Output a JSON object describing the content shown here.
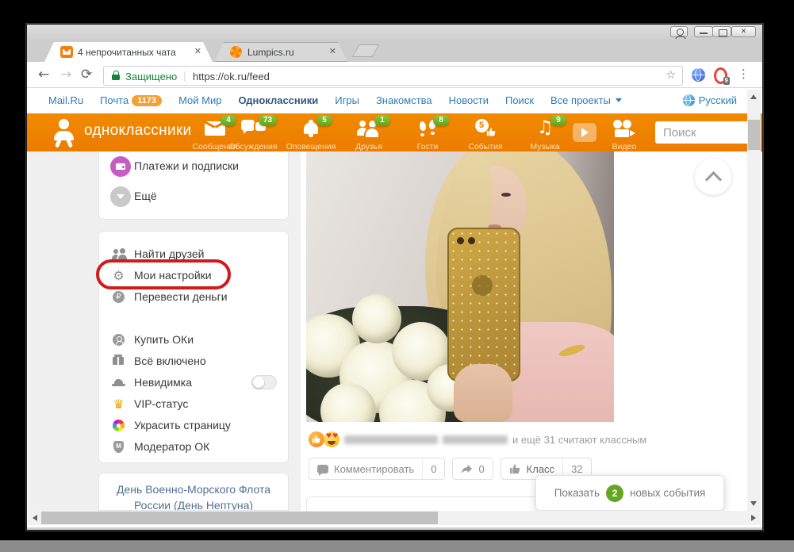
{
  "colors": {
    "accent_orange": "#ee7d00",
    "badge_green": "#76b82e",
    "nav_blue": "#2d7cb8",
    "annotation_red": "#d11a1a",
    "toast_green": "#63a620",
    "security_green": "#188038"
  },
  "browser": {
    "tabs": [
      {
        "title": "4 непрочитанных чата",
        "close": "✕"
      },
      {
        "title": "Lumpics.ru",
        "close": "✕"
      }
    ],
    "toolbar": {
      "back": "←",
      "forward": "→",
      "reload": "⟳",
      "security_label": "Защищено",
      "divider": "|",
      "url": "https://ok.ru/feed",
      "star": "☆",
      "ext_badge": "9",
      "menu": "⋮"
    }
  },
  "topnav": {
    "items": [
      {
        "label": "Mail.Ru"
      },
      {
        "label": "Почта",
        "badge": "1173"
      },
      {
        "label": "Мой Мир"
      },
      {
        "label": "Одноклассники"
      },
      {
        "label": "Игры"
      },
      {
        "label": "Знакомства"
      },
      {
        "label": "Новости"
      },
      {
        "label": "Поиск"
      },
      {
        "label": "Все проекты"
      }
    ],
    "language": "Русский"
  },
  "okheader": {
    "logo_text": "одноклассники",
    "nav": [
      {
        "label": "Сообщения",
        "badge": "4"
      },
      {
        "label": "Обсуждения",
        "badge": "73"
      },
      {
        "label": "Оповещения",
        "badge": "5"
      },
      {
        "label": "Друзья",
        "badge": "1"
      },
      {
        "label": "Гости",
        "badge": "8"
      },
      {
        "label": "События",
        "icon_digit": "5"
      },
      {
        "label": "Музыка",
        "badge": "9",
        "note_glyph": "♫"
      },
      {
        "label": "Видео"
      }
    ],
    "search_placeholder": "Поиск"
  },
  "sidebar": {
    "top": [
      {
        "label": "Платежи и подписки"
      },
      {
        "label": "Ещё"
      }
    ],
    "menu": [
      {
        "label": "Найти друзей"
      },
      {
        "label": "Мои настройки",
        "gear_glyph": "⚙"
      },
      {
        "label": "Перевести деньги",
        "ruble_glyph": "₽"
      },
      {
        "label": "Купить ОКи"
      },
      {
        "label": "Всё включено"
      },
      {
        "label": "Невидимка"
      },
      {
        "label": "VIP-статус",
        "crown_glyph": "♛"
      },
      {
        "label": "Украсить страницу"
      },
      {
        "label": "Модератор ОК",
        "shield_letter": "М"
      }
    ],
    "holiday_line1": "День Военно-Морского Флота",
    "holiday_line2": "России (День Нептуна)"
  },
  "feed": {
    "likes_text": "и ещё 31 считают классным",
    "comment_label": "Комментировать",
    "comment_count": "0",
    "share_count": "0",
    "class_label": "Класс",
    "class_count": "32"
  },
  "toast": {
    "show": "Показать",
    "count": "2",
    "rest": "новых события"
  },
  "glyphs": {
    "heart": "♥",
    "close": "✕"
  }
}
